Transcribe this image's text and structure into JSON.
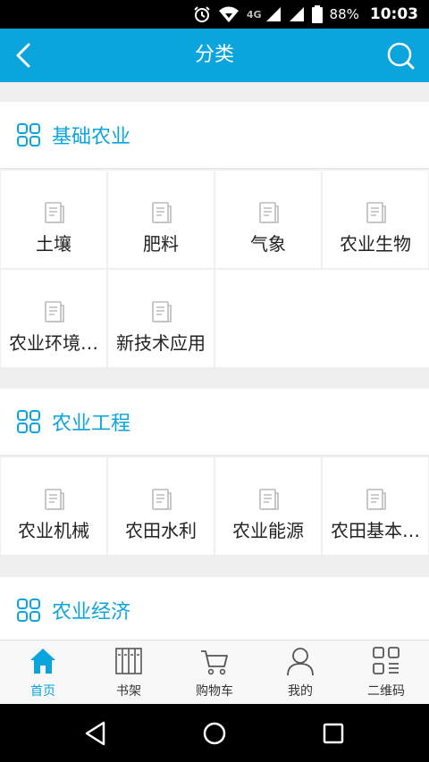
{
  "status_bar": {
    "network": "4G",
    "battery_percent": "88%",
    "time": "10:03"
  },
  "app_bar": {
    "title": "分类"
  },
  "sections": [
    {
      "title": "基础农业",
      "items": [
        "土壤",
        "肥料",
        "气象",
        "农业生物",
        "农业环境…",
        "新技术应用"
      ]
    },
    {
      "title": "农业工程",
      "items": [
        "农业机械",
        "农田水利",
        "农业能源",
        "农田基本…"
      ]
    },
    {
      "title": "农业经济",
      "items": []
    }
  ],
  "tab_bar": {
    "tabs": [
      {
        "label": "首页",
        "icon": "home-icon",
        "active": true
      },
      {
        "label": "书架",
        "icon": "bookshelf-icon",
        "active": false
      },
      {
        "label": "购物车",
        "icon": "cart-icon",
        "active": false
      },
      {
        "label": "我的",
        "icon": "user-icon",
        "active": false
      },
      {
        "label": "二维码",
        "icon": "qr-code-icon",
        "active": false
      }
    ]
  },
  "colors": {
    "accent": "#0aa5dd",
    "background": "#efefef"
  }
}
